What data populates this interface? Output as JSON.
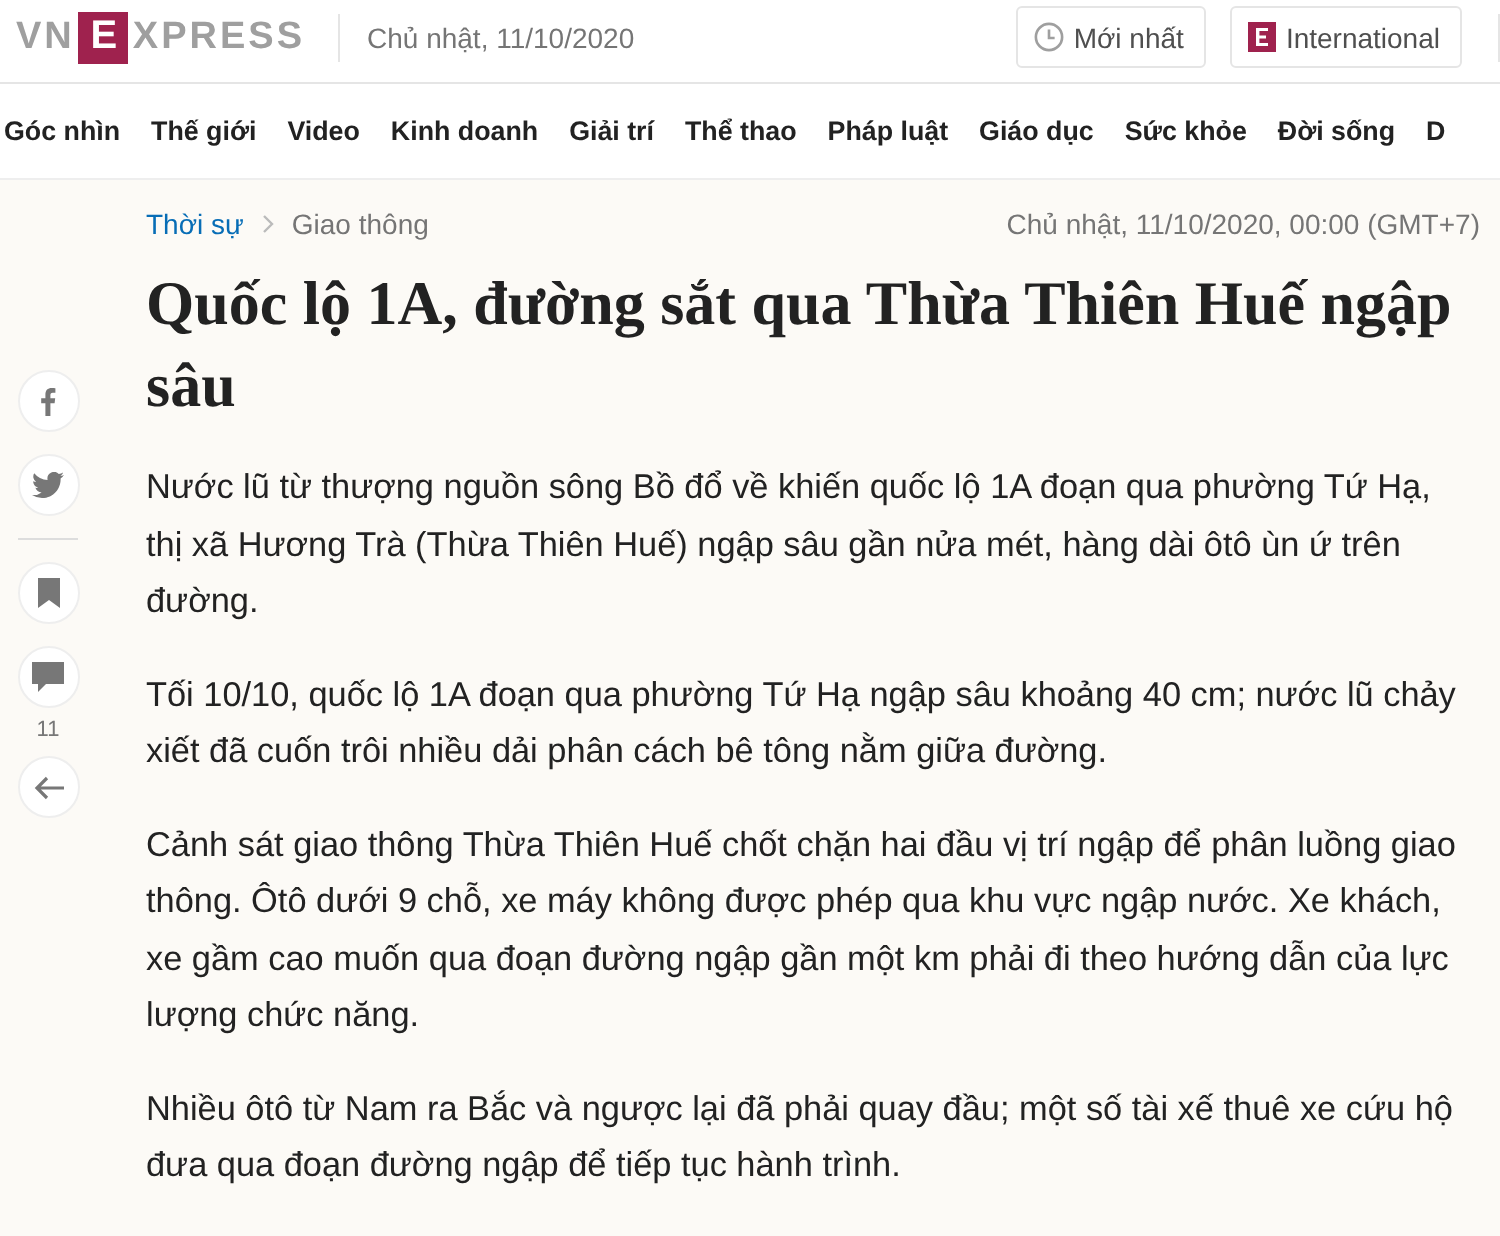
{
  "header": {
    "logo": {
      "left": "VN",
      "box": "E",
      "right": "XPRESS"
    },
    "date": "Chủ nhật, 11/10/2020",
    "buttons": [
      {
        "kind": "latest",
        "label": "Mới nhất"
      },
      {
        "kind": "international",
        "label": "International"
      }
    ]
  },
  "nav": {
    "items": [
      "Góc nhìn",
      "Thế giới",
      "Video",
      "Kinh doanh",
      "Giải trí",
      "Thể thao",
      "Pháp luật",
      "Giáo dục",
      "Sức khỏe",
      "Đời sống",
      "D"
    ]
  },
  "share": {
    "items": [
      {
        "kind": "facebook"
      },
      {
        "kind": "twitter"
      },
      {
        "kind": "divider"
      },
      {
        "kind": "bookmark"
      },
      {
        "kind": "comment",
        "count": "11"
      },
      {
        "kind": "back"
      }
    ]
  },
  "article": {
    "breadcrumb": [
      "Thời sự",
      "Giao thông"
    ],
    "published": "Chủ nhật, 11/10/2020, 00:00 (GMT+7)",
    "title": "Quốc lộ 1A, đường sắt qua Thừa Thiên Huế ngập sâu",
    "paragraphs": [
      "Nước lũ từ thượng nguồn sông Bồ đổ về khiến quốc lộ 1A đoạn qua phường Tứ Hạ, thị xã Hương Trà (Thừa Thiên Huế) ngập sâu gần nửa mét, hàng dài ôtô ùn ứ trên đường.",
      "Tối 10/10, quốc lộ 1A đoạn qua phường Tứ Hạ ngập sâu khoảng 40 cm; nước lũ chảy xiết đã cuốn trôi nhiều dải phân cách bê tông nằm giữa đường.",
      "Cảnh sát giao thông Thừa Thiên Huế chốt chặn hai đầu vị trí ngập để phân luồng giao thông. Ôtô dưới 9 chỗ, xe máy không được phép qua khu vực ngập nước. Xe khách, xe gầm cao muốn qua đoạn đường ngập gần một km phải đi theo hướng dẫn của lực lượng chức năng.",
      "Nhiều ôtô từ Nam ra Bắc và ngược lại đã phải quay đầu; một số tài xế thuê xe cứu hộ đưa qua đoạn đường ngập để tiếp tục hành trình."
    ]
  }
}
